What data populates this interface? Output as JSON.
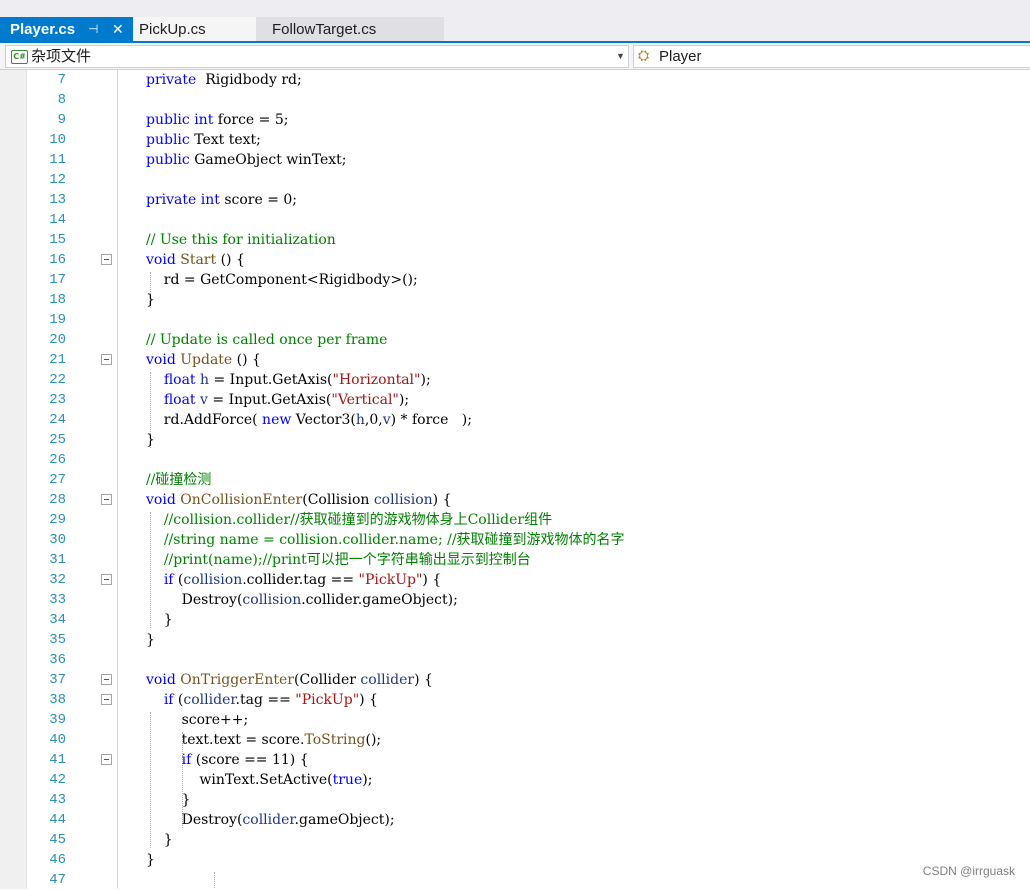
{
  "tabs": [
    {
      "label": "Player.cs",
      "pin_glyph": "⊣",
      "close_glyph": "✕"
    },
    {
      "label": "PickUp.cs"
    },
    {
      "label": "FollowTarget.cs"
    }
  ],
  "nav": {
    "project": "杂项文件",
    "class_name": "Player"
  },
  "colors": {
    "accent": "#007acc",
    "keyword": "#0000ff",
    "type": "#2b91af",
    "string": "#a31515",
    "comment": "#008000",
    "line_number": "#2b91af"
  },
  "lines": [
    {
      "num": "7",
      "fold": false,
      "code": [
        [
          "k",
          "private"
        ],
        [
          "",
          "  Rigidbody rd;"
        ]
      ]
    },
    {
      "num": "8",
      "fold": false,
      "code": []
    },
    {
      "num": "9",
      "fold": false,
      "code": [
        [
          "k",
          "public"
        ],
        [
          "",
          " "
        ],
        [
          "k",
          "int"
        ],
        [
          "",
          " force = 5;"
        ]
      ]
    },
    {
      "num": "10",
      "fold": false,
      "code": [
        [
          "k",
          "public"
        ],
        [
          "",
          " Text text;"
        ]
      ]
    },
    {
      "num": "11",
      "fold": false,
      "code": [
        [
          "k",
          "public"
        ],
        [
          "",
          " GameObject winText;"
        ]
      ]
    },
    {
      "num": "12",
      "fold": false,
      "code": []
    },
    {
      "num": "13",
      "fold": false,
      "code": [
        [
          "k",
          "private"
        ],
        [
          "",
          " "
        ],
        [
          "k",
          "int"
        ],
        [
          "",
          " score = 0;"
        ]
      ]
    },
    {
      "num": "14",
      "fold": false,
      "code": []
    },
    {
      "num": "15",
      "fold": false,
      "code": [
        [
          "c",
          "// Use this for initialization"
        ]
      ]
    },
    {
      "num": "16",
      "fold": true,
      "code": [
        [
          "k",
          "void"
        ],
        [
          "",
          " "
        ],
        [
          "m",
          "Start"
        ],
        [
          "",
          " () {"
        ]
      ]
    },
    {
      "num": "17",
      "fold": false,
      "code": [
        [
          "",
          "    rd = GetComponent<Rigidbody>();"
        ]
      ]
    },
    {
      "num": "18",
      "fold": false,
      "code": [
        [
          "",
          "}"
        ]
      ]
    },
    {
      "num": "19",
      "fold": false,
      "code": []
    },
    {
      "num": "20",
      "fold": false,
      "code": [
        [
          "c",
          "// Update is called once per frame"
        ]
      ]
    },
    {
      "num": "21",
      "fold": true,
      "code": [
        [
          "k",
          "void"
        ],
        [
          "",
          " "
        ],
        [
          "m",
          "Update"
        ],
        [
          "",
          " () {"
        ]
      ]
    },
    {
      "num": "22",
      "fold": false,
      "code": [
        [
          "",
          "    "
        ],
        [
          "k",
          "float"
        ],
        [
          "",
          " "
        ],
        [
          "p",
          "h"
        ],
        [
          "",
          " = Input.GetAxis("
        ],
        [
          "s",
          "\"Horizontal\""
        ],
        [
          "",
          ");"
        ]
      ]
    },
    {
      "num": "23",
      "fold": false,
      "code": [
        [
          "",
          "    "
        ],
        [
          "k",
          "float"
        ],
        [
          "",
          " "
        ],
        [
          "p",
          "v"
        ],
        [
          "",
          " = Input.GetAxis("
        ],
        [
          "s",
          "\"Vertical\""
        ],
        [
          "",
          ");"
        ]
      ]
    },
    {
      "num": "24",
      "fold": false,
      "code": [
        [
          "",
          "    rd.AddForce( "
        ],
        [
          "k",
          "new"
        ],
        [
          "",
          " Vector3("
        ],
        [
          "p",
          "h"
        ],
        [
          "",
          ",0,"
        ],
        [
          "p",
          "v"
        ],
        [
          "",
          ") * force   );"
        ]
      ]
    },
    {
      "num": "25",
      "fold": false,
      "code": [
        [
          "",
          "}"
        ]
      ]
    },
    {
      "num": "26",
      "fold": false,
      "code": []
    },
    {
      "num": "27",
      "fold": false,
      "code": [
        [
          "c",
          "//碰撞检测"
        ]
      ]
    },
    {
      "num": "28",
      "fold": true,
      "code": [
        [
          "k",
          "void"
        ],
        [
          "",
          " "
        ],
        [
          "m",
          "OnCollisionEnter"
        ],
        [
          "",
          "(Collision "
        ],
        [
          "p",
          "collision"
        ],
        [
          "",
          ") {"
        ]
      ]
    },
    {
      "num": "29",
      "fold": false,
      "code": [
        [
          "",
          "    "
        ],
        [
          "c",
          "//collision.collider//获取碰撞到的游戏物体身上Collider组件"
        ]
      ]
    },
    {
      "num": "30",
      "fold": false,
      "code": [
        [
          "",
          "    "
        ],
        [
          "c",
          "//string name = collision.collider.name; //获取碰撞到游戏物体的名字"
        ]
      ]
    },
    {
      "num": "31",
      "fold": false,
      "code": [
        [
          "",
          "    "
        ],
        [
          "c",
          "//print(name);//print可以把一个字符串输出显示到控制台"
        ]
      ]
    },
    {
      "num": "32",
      "fold": true,
      "code": [
        [
          "",
          "    "
        ],
        [
          "k",
          "if"
        ],
        [
          "",
          " ("
        ],
        [
          "p",
          "collision"
        ],
        [
          "",
          ".collider.tag == "
        ],
        [
          "s",
          "\"PickUp\""
        ],
        [
          "",
          ") {"
        ]
      ]
    },
    {
      "num": "33",
      "fold": false,
      "code": [
        [
          "",
          "        Destroy("
        ],
        [
          "p",
          "collision"
        ],
        [
          "",
          ".collider.gameObject);"
        ]
      ]
    },
    {
      "num": "34",
      "fold": false,
      "code": [
        [
          "",
          "    }"
        ]
      ]
    },
    {
      "num": "35",
      "fold": false,
      "code": [
        [
          "",
          "}"
        ]
      ]
    },
    {
      "num": "36",
      "fold": false,
      "code": []
    },
    {
      "num": "37",
      "fold": true,
      "code": [
        [
          "k",
          "void"
        ],
        [
          "",
          " "
        ],
        [
          "m",
          "OnTriggerEnter"
        ],
        [
          "",
          "(Collider "
        ],
        [
          "p",
          "collider"
        ],
        [
          "",
          ") {"
        ]
      ]
    },
    {
      "num": "38",
      "fold": true,
      "code": [
        [
          "",
          "    "
        ],
        [
          "k",
          "if"
        ],
        [
          "",
          " ("
        ],
        [
          "p",
          "collider"
        ],
        [
          "",
          ".tag == "
        ],
        [
          "s",
          "\"PickUp\""
        ],
        [
          "",
          ") {"
        ]
      ]
    },
    {
      "num": "39",
      "fold": false,
      "code": [
        [
          "",
          "        score++;"
        ]
      ]
    },
    {
      "num": "40",
      "fold": false,
      "code": [
        [
          "",
          "        text.text = score."
        ],
        [
          "m",
          "ToString"
        ],
        [
          "",
          "();"
        ]
      ]
    },
    {
      "num": "41",
      "fold": true,
      "code": [
        [
          "",
          "        "
        ],
        [
          "k",
          "if"
        ],
        [
          "",
          " (score == 11) {"
        ]
      ]
    },
    {
      "num": "42",
      "fold": false,
      "code": [
        [
          "",
          "            winText.SetActive("
        ],
        [
          "k",
          "true"
        ],
        [
          "",
          ");"
        ]
      ]
    },
    {
      "num": "43",
      "fold": false,
      "code": [
        [
          "",
          "        }"
        ]
      ]
    },
    {
      "num": "44",
      "fold": false,
      "code": [
        [
          "",
          "        Destroy("
        ],
        [
          "p",
          "collider"
        ],
        [
          "",
          ".gameObject);"
        ]
      ]
    },
    {
      "num": "45",
      "fold": false,
      "code": [
        [
          "",
          "    }"
        ]
      ]
    },
    {
      "num": "46",
      "fold": false,
      "code": [
        [
          "",
          "}"
        ]
      ]
    },
    {
      "num": "47",
      "fold": false,
      "code": []
    }
  ],
  "watermark": "CSDN @irrguask"
}
